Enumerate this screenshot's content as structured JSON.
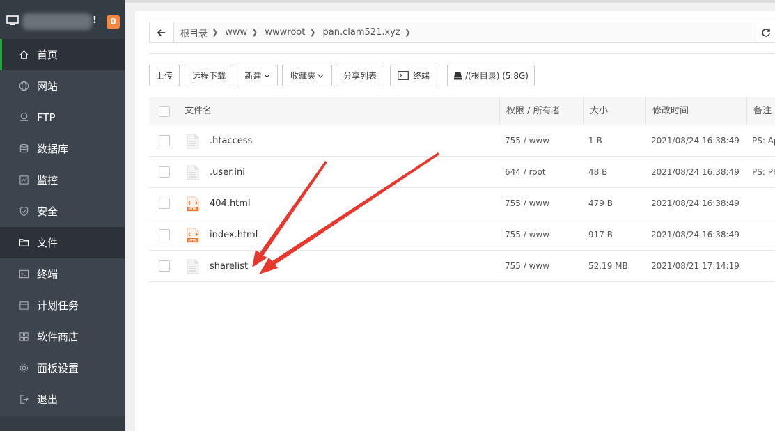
{
  "sidebar": {
    "badge": "0",
    "host_glyph": "!",
    "items": [
      {
        "label": "首页",
        "icon": "home-icon"
      },
      {
        "label": "网站",
        "icon": "globe-icon"
      },
      {
        "label": "FTP",
        "icon": "ftp-icon"
      },
      {
        "label": "数据库",
        "icon": "database-icon"
      },
      {
        "label": "监控",
        "icon": "monitor-icon"
      },
      {
        "label": "安全",
        "icon": "shield-icon"
      },
      {
        "label": "文件",
        "icon": "folder-icon"
      },
      {
        "label": "终端",
        "icon": "terminal-icon"
      },
      {
        "label": "计划任务",
        "icon": "calendar-icon"
      },
      {
        "label": "软件商店",
        "icon": "grid-icon"
      },
      {
        "label": "面板设置",
        "icon": "gear-icon"
      },
      {
        "label": "退出",
        "icon": "logout-icon"
      }
    ]
  },
  "path": {
    "crumbs": [
      "根目录",
      "www",
      "wwwroot",
      "pan.clam521.xyz"
    ]
  },
  "toolbar": {
    "upload": "上传",
    "remote_download": "远程下载",
    "new": "新建",
    "favorites": "收藏夹",
    "share_list": "分享列表",
    "terminal": "终端",
    "disk": "/(根目录) (5.8G)"
  },
  "table": {
    "headers": {
      "name": "文件名",
      "perm": "权限 / 所有者",
      "size": "大小",
      "mtime": "修改时间",
      "note": "备注"
    },
    "rows": [
      {
        "name": ".htaccess",
        "type": "text",
        "perm": "755 / www",
        "size": "1 B",
        "mtime": "2021/08/24 16:38:49",
        "note": "PS: Ap"
      },
      {
        "name": ".user.ini",
        "type": "text",
        "perm": "644 / root",
        "size": "48 B",
        "mtime": "2021/08/24 16:38:49",
        "note": "PS: PH"
      },
      {
        "name": "404.html",
        "type": "html",
        "perm": "755 / www",
        "size": "479 B",
        "mtime": "2021/08/24 16:38:49",
        "note": ""
      },
      {
        "name": "index.html",
        "type": "html",
        "perm": "755 / www",
        "size": "917 B",
        "mtime": "2021/08/24 16:38:49",
        "note": ""
      },
      {
        "name": "sharelist",
        "type": "text",
        "perm": "755 / www",
        "size": "52.19 MB",
        "mtime": "2021/08/21 17:14:19",
        "note": ""
      }
    ]
  },
  "colors": {
    "accent_green": "#20a53a",
    "badge_orange": "#f7873f",
    "annotation_red": "#e8372c"
  }
}
